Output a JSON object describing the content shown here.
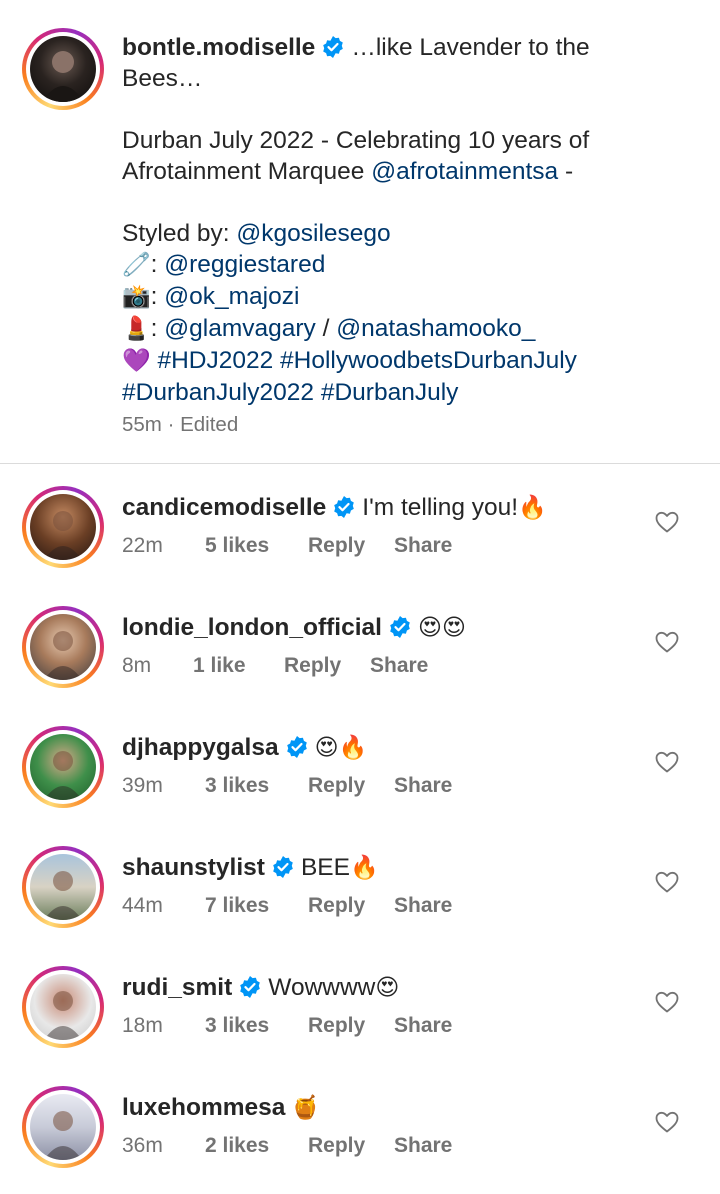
{
  "post": {
    "username": "bontle.modiselle",
    "caption_first": "…like Lavender to the",
    "caption_lines": [
      "Bees…",
      "",
      "Durban July 2022 - Celebrating 10 years of",
      "Afrotainment Marquee",
      "Styled by:",
      ": ",
      ": ",
      ": ",
      " / "
    ],
    "mentions": {
      "afrotainment": "@afrotainmentsa",
      "stylist": "@kgosilesego",
      "pin": "@reggiestared",
      "photo": "@ok_majozi",
      "glam1": "@glamvagary",
      "glam2": "@natashamooko_"
    },
    "trailing_dash": " -",
    "hashtags_line1": "#HDJ2022 #HollywoodbetsDurbanJuly",
    "hashtags_line2": "#DurbanJuly2022 #DurbanJuly",
    "time": "55m · Edited"
  },
  "comments": [
    {
      "username": "candicemodiselle",
      "text": "I'm telling you!",
      "emoji": "🔥",
      "time": "22m",
      "likes": "5 likes",
      "reply": "Reply",
      "share": "Share"
    },
    {
      "username": "londie_london_official",
      "text": "",
      "emoji": "😍😍",
      "time": "8m",
      "likes": "1 like",
      "reply": "Reply",
      "share": "Share"
    },
    {
      "username": "djhappygalsa",
      "text": "",
      "emoji": "😍🔥",
      "time": "39m",
      "likes": "3 likes",
      "reply": "Reply",
      "share": "Share"
    },
    {
      "username": "shaunstylist",
      "text": "BEE",
      "emoji": "🔥",
      "time": "44m",
      "likes": "7 likes",
      "reply": "Reply",
      "share": "Share"
    },
    {
      "username": "rudi_smit",
      "text": "Wowwww",
      "emoji": "😍",
      "time": "18m",
      "likes": "3 likes",
      "reply": "Reply",
      "share": "Share"
    },
    {
      "username": "luxehommesa",
      "text": "",
      "emoji": "🍯",
      "time": "36m",
      "likes": "2 likes",
      "reply": "Reply",
      "share": "Share"
    }
  ],
  "icons": {
    "verified": "verified-badge-icon",
    "heart": "heart-outline-icon",
    "pin_emoji": "🧷",
    "camera_emoji": "📸",
    "lipstick_emoji": "💄",
    "heart_emoji": "💜"
  },
  "colors": {
    "verified": "#0095f6",
    "link": "#00376b",
    "muted": "#737373"
  }
}
